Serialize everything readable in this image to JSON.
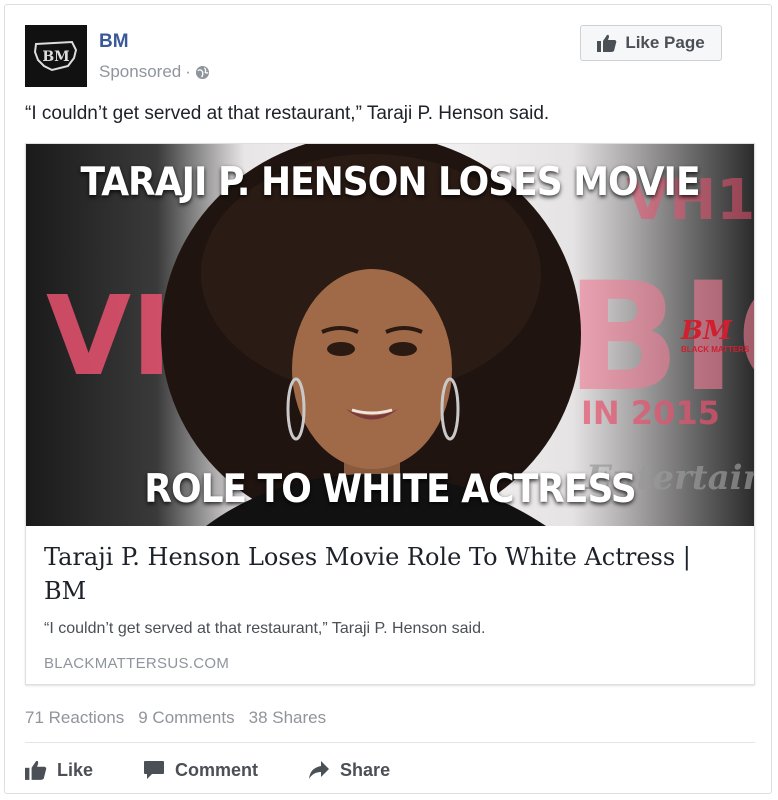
{
  "post": {
    "page_name": "BM",
    "sponsored_label": "Sponsored",
    "separator": "·",
    "like_page_label": "Like Page",
    "text": "“I couldn’t get served at that restaurant,” Taraji P. Henson said."
  },
  "link": {
    "image": {
      "headline_top": "TARAJI P. HENSON LOSES MOVIE",
      "headline_bottom": "ROLE TO WHITE ACTRESS",
      "watermark_logo": "BM",
      "watermark_sub": "BLACK MATTERS",
      "bg_text_left": "VH",
      "bg_text_right_top": "VH1",
      "bg_text_right_mid": "BIG",
      "bg_text_right_year": "IN 2015",
      "bg_text_right_bottom": "Entertainment"
    },
    "title": "Taraji P. Henson Loses Movie Role To White Actress | BM",
    "description": "“I couldn’t get served at that restaurant,” Taraji P. Henson said.",
    "domain": "BLACKMATTERSUS.COM"
  },
  "engagement": {
    "reactions": "71 Reactions",
    "comments": "9 Comments",
    "shares": "38 Shares"
  },
  "actions": {
    "like": "Like",
    "comment": "Comment",
    "share": "Share"
  },
  "avatar_text": "BM",
  "colors": {
    "link_blue": "#3b5998",
    "muted": "#90949c",
    "text": "#1d2129",
    "vh1_pink": "#e8526f"
  },
  "icons": [
    "globe-icon",
    "thumbs-up-icon",
    "comment-icon",
    "share-arrow-icon"
  ]
}
